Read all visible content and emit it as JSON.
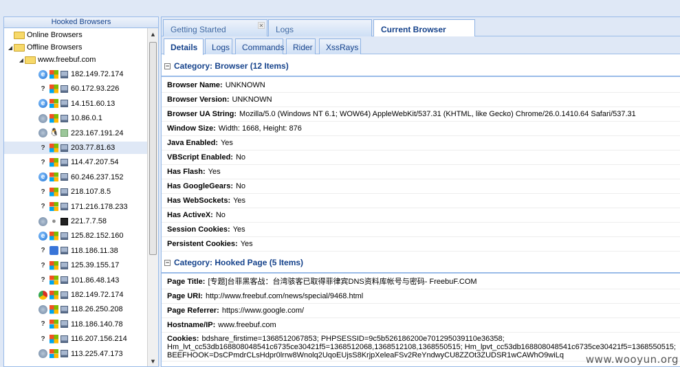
{
  "tree": {
    "title": "Hooked Browsers",
    "online_label": "Online Browsers",
    "offline_label": "Offline Browsers",
    "domain_label": "www.freebuf.com",
    "hosts": [
      {
        "ip": "182.149.72.174",
        "browser": "ie-icon",
        "os": "windows-icon",
        "hw": "computer-icon"
      },
      {
        "ip": "60.172.93.226",
        "browser": "unknown-icon",
        "os": "windows-icon",
        "hw": "computer-icon"
      },
      {
        "ip": "14.151.60.13",
        "browser": "ie-icon",
        "os": "windows-icon",
        "hw": "computer-icon"
      },
      {
        "ip": "10.86.0.1",
        "browser": "generic-browser-icon",
        "os": "windows-icon",
        "hw": "computer-icon"
      },
      {
        "ip": "223.167.191.24",
        "browser": "generic-browser-icon",
        "os": "linux-icon",
        "hw": "device-icon"
      },
      {
        "ip": "203.77.81.63",
        "browser": "unknown-icon",
        "os": "windows-icon",
        "hw": "computer-icon"
      },
      {
        "ip": "114.47.207.54",
        "browser": "unknown-icon",
        "os": "windows-icon",
        "hw": "computer-icon"
      },
      {
        "ip": "60.246.237.152",
        "browser": "ie-icon",
        "os": "windows-icon",
        "hw": "computer-icon"
      },
      {
        "ip": "218.107.8.5",
        "browser": "unknown-icon",
        "os": "windows-icon",
        "hw": "computer-icon"
      },
      {
        "ip": "171.216.178.233",
        "browser": "unknown-icon",
        "os": "windows-icon",
        "hw": "computer-icon"
      },
      {
        "ip": "221.7.7.58",
        "browser": "generic-browser-icon",
        "os": "apple-icon",
        "hw": "phone-icon"
      },
      {
        "ip": "125.82.152.160",
        "browser": "ie-icon",
        "os": "windows-icon",
        "hw": "computer-icon"
      },
      {
        "ip": "118.186.11.38",
        "browser": "unknown-icon",
        "os": "ios-icon",
        "hw": "computer-icon"
      },
      {
        "ip": "125.39.155.17",
        "browser": "unknown-icon",
        "os": "windows-icon",
        "hw": "computer-icon"
      },
      {
        "ip": "101.86.48.143",
        "browser": "unknown-icon",
        "os": "windows-icon",
        "hw": "computer-icon"
      },
      {
        "ip": "182.149.72.174",
        "browser": "chrome-icon",
        "os": "windows-icon",
        "hw": "computer-icon"
      },
      {
        "ip": "118.26.250.208",
        "browser": "generic-browser-icon",
        "os": "windows-icon",
        "hw": "computer-icon"
      },
      {
        "ip": "118.186.140.78",
        "browser": "unknown-icon",
        "os": "windows-icon",
        "hw": "computer-icon"
      },
      {
        "ip": "116.207.156.214",
        "browser": "unknown-icon",
        "os": "windows-icon",
        "hw": "computer-icon"
      },
      {
        "ip": "113.225.47.173",
        "browser": "generic-browser-icon",
        "os": "windows-icon",
        "hw": "computer-icon"
      }
    ]
  },
  "main_tabs": [
    {
      "label": "Getting Started",
      "closable": true
    },
    {
      "label": "Logs"
    },
    {
      "label": "Current Browser",
      "active": true
    }
  ],
  "sub_tabs": [
    {
      "label": "Details",
      "active": true
    },
    {
      "label": "Logs"
    },
    {
      "label": "Commands"
    },
    {
      "label": "Rider"
    },
    {
      "label": "XssRays"
    }
  ],
  "categories": [
    {
      "title": "Category: Browser (12 Items)",
      "rows": [
        {
          "label": "Browser Name:",
          "value": "UNKNOWN"
        },
        {
          "label": "Browser Version:",
          "value": "UNKNOWN"
        },
        {
          "label": "Browser UA String:",
          "value": "Mozilla/5.0 (Windows NT 6.1; WOW64) AppleWebKit/537.31 (KHTML, like Gecko) Chrome/26.0.1410.64 Safari/537.31"
        },
        {
          "label": "Window Size:",
          "value": "Width: 1668, Height: 876"
        },
        {
          "label": "Java Enabled:",
          "value": "Yes"
        },
        {
          "label": "VBScript Enabled:",
          "value": "No"
        },
        {
          "label": "Has Flash:",
          "value": "Yes"
        },
        {
          "label": "Has GoogleGears:",
          "value": "No"
        },
        {
          "label": "Has WebSockets:",
          "value": "Yes"
        },
        {
          "label": "Has ActiveX:",
          "value": "No"
        },
        {
          "label": "Session Cookies:",
          "value": "Yes"
        },
        {
          "label": "Persistent Cookies:",
          "value": "Yes"
        }
      ]
    },
    {
      "title": "Category: Hooked Page (5 Items)",
      "rows": [
        {
          "label": "Page Title:",
          "value": "[专题]台菲黑客战：台湾骇客已取得菲律宾DNS资料库帐号与密码- FreebuF.COM"
        },
        {
          "label": "Page URI:",
          "value": "http://www.freebuf.com/news/special/9468.html"
        },
        {
          "label": "Page Referrer:",
          "value": "https://www.google.com/"
        },
        {
          "label": "Hostname/IP:",
          "value": "www.freebuf.com"
        },
        {
          "label": "Cookies:",
          "value": "bdshare_firstime=1368512067853; PHPSESSID=9c5b526186200e701295039110e36358; Hm_lvt_cc53db168808048541c6735ce30421f5=1368512068,1368512108,1368550515; Hm_lpvt_cc53db168808048541c6735ce30421f5=1368550515; BEEFHOOK=DsCPmdrCLsHdpr0lrrw8Wnolq2UqoEUjsS8KrjpXeleaFSv2ReYndwyCU8ZZOt3ZUDSR1wCAWhO9wiLq"
        }
      ]
    }
  ],
  "watermark": "www.wooyun.org",
  "colors": {
    "panel_bg": "#dfe8f6",
    "border": "#99bbe8",
    "header_text": "#15428b"
  }
}
